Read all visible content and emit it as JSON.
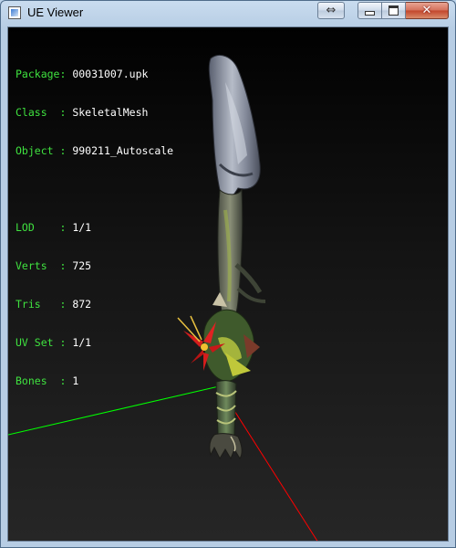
{
  "window": {
    "title": "UE Viewer"
  },
  "titlebar_buttons": {
    "extra_icon": "resize-arrows-icon",
    "minimize_icon": "minimize-icon",
    "maximize_icon": "maximize-icon",
    "close_icon": "close-icon",
    "close_glyph": "✕",
    "extra_glyph": "⇔"
  },
  "info": {
    "package": {
      "label": "Package:",
      "value": "00031007.upk"
    },
    "class": {
      "label": "Class  :",
      "value": "SkeletalMesh"
    },
    "object": {
      "label": "Object :",
      "value": "990211_Autoscale"
    },
    "lod": {
      "label": "LOD    :",
      "value": "1/1"
    },
    "verts": {
      "label": "Verts  :",
      "value": "725"
    },
    "tris": {
      "label": "Tris   :",
      "value": "872"
    },
    "uvset": {
      "label": "UV Set :",
      "value": "1/1"
    },
    "bones": {
      "label": "Bones  :",
      "value": "1"
    }
  },
  "colors": {
    "label_text": "#3fe23f",
    "value_text": "#ffffff",
    "axis_x": "#ff0000",
    "axis_y": "#00ff00",
    "viewport_top": "#010101",
    "viewport_bottom": "#262626"
  }
}
